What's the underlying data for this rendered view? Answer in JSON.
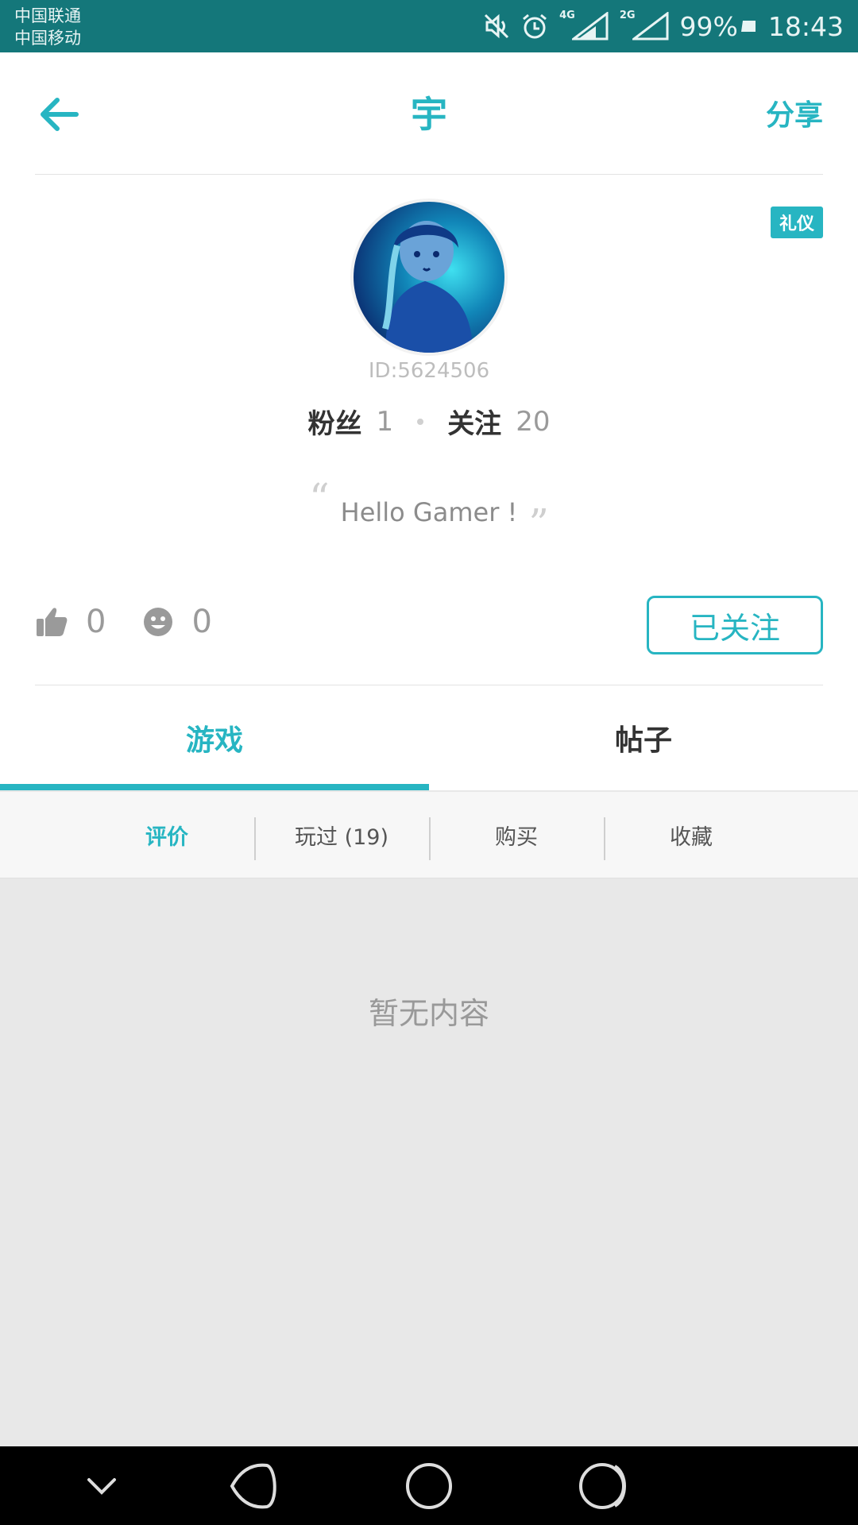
{
  "status_bar": {
    "carrier_1": "中国联通",
    "carrier_2": "中国移动",
    "network_1": "4G",
    "network_2": "2G",
    "battery": "99%",
    "time": "18:43",
    "icons": [
      "mute-icon",
      "alarm-icon",
      "signal-icon",
      "battery-icon"
    ]
  },
  "header": {
    "back_icon": "arrow-left-icon",
    "title": "宇",
    "share_label": "分享"
  },
  "profile": {
    "badge": "礼仪",
    "user_id": "ID:5624506",
    "fans_label": "粉丝",
    "fans_count": "1",
    "following_label": "关注",
    "following_count": "20",
    "bio": "Hello Gamer !",
    "likes_count": "0",
    "smiles_count": "0",
    "follow_button": "已关注"
  },
  "tabs": [
    {
      "label": "游戏",
      "active": true
    },
    {
      "label": "帖子",
      "active": false
    }
  ],
  "sub_tabs": [
    {
      "label": "评价",
      "active": true
    },
    {
      "label": "玩过 (19)",
      "active": false
    },
    {
      "label": "购买",
      "active": false
    },
    {
      "label": "收藏",
      "active": false
    }
  ],
  "empty_text": "暂无内容",
  "colors": {
    "accent": "#27b5c2",
    "status_bar": "#14777a",
    "background": "#e8e8e8"
  }
}
